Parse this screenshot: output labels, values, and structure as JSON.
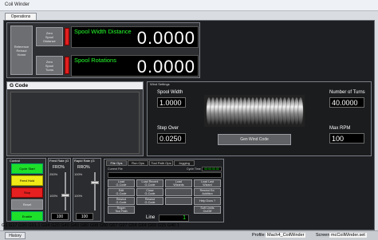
{
  "window": {
    "title": "Coil Winder"
  },
  "tabs": {
    "operations": "Operations"
  },
  "left_ref_button": "Reference\nRetract\nHome",
  "spool_width": {
    "zero_label": "Zero\nSpool\nDistance",
    "label": "Spool Width Distance",
    "value": "0.0000"
  },
  "spool_rotations": {
    "zero_label": "Zero\nSpool\nTurns",
    "label": "Spool Rotations",
    "value": "0.0000"
  },
  "gcode": {
    "title": "G Code"
  },
  "wind_settings": {
    "title": "Wind Settings",
    "spool_width_label": "Spool Width",
    "spool_width_value": "1.0000",
    "turns_label": "Number of Turns",
    "turns_value": "40.0000",
    "step_over_label": "Step Over",
    "step_over_value": "0.0250",
    "max_rpm_label": "Max RPM",
    "max_rpm_value": "100",
    "gen_button": "Gen Wind Code"
  },
  "control": {
    "title": "Control",
    "cycle_start": "Cycle Start",
    "feed_hold": "Feed Hold",
    "stop": "Stop",
    "reset": "Reset",
    "enable": "Enable"
  },
  "feed_rate": {
    "title": "Feed Rate (G",
    "label": "FRO%",
    "value_top": "250%",
    "value_bottom": "100%",
    "bottom_box": "100"
  },
  "rapid_rate": {
    "title": "Rapid Rate (G",
    "label": "RRO%",
    "value_top": "100%",
    "value_bottom": "100%",
    "bottom_box": "100"
  },
  "file_ops": {
    "tabs": [
      "File Ops",
      "Run Ops",
      "Tool Path Ops",
      "Jogging"
    ],
    "current_file_label": "Current File",
    "cycle_time_label": "Cycle Time",
    "cycle_time_value": "00:00:00.00",
    "buttons": [
      "Load\nG-Code",
      "Load Recent\nG-Code",
      "Load\nWizards",
      "Load Last\nWizard",
      "Edit\nG-Code",
      "Close\nG-Code",
      "",
      "Rewind Ed.\nAddition",
      "Rewind\nG-Code",
      "Rewind\nG-Code",
      "",
      "Help Docs ?",
      "Regen\nTool Path",
      "",
      "",
      "Soft Limits\nOn/Off"
    ],
    "line_label": "Line",
    "line_value": "1"
  },
  "gcode_line": "G1 G17 G90 G91.1 G94 G20 G40 G49 G80 G98 G50 G67 G97 G54 G64 G69 G15 G40.1",
  "status": {
    "history_button": "History",
    "profile_label": "Profile:",
    "profile_value": "Mach4_CoilWinder",
    "screen_label": "Screen:",
    "screen_value": "mcCoilWinder.set"
  }
}
